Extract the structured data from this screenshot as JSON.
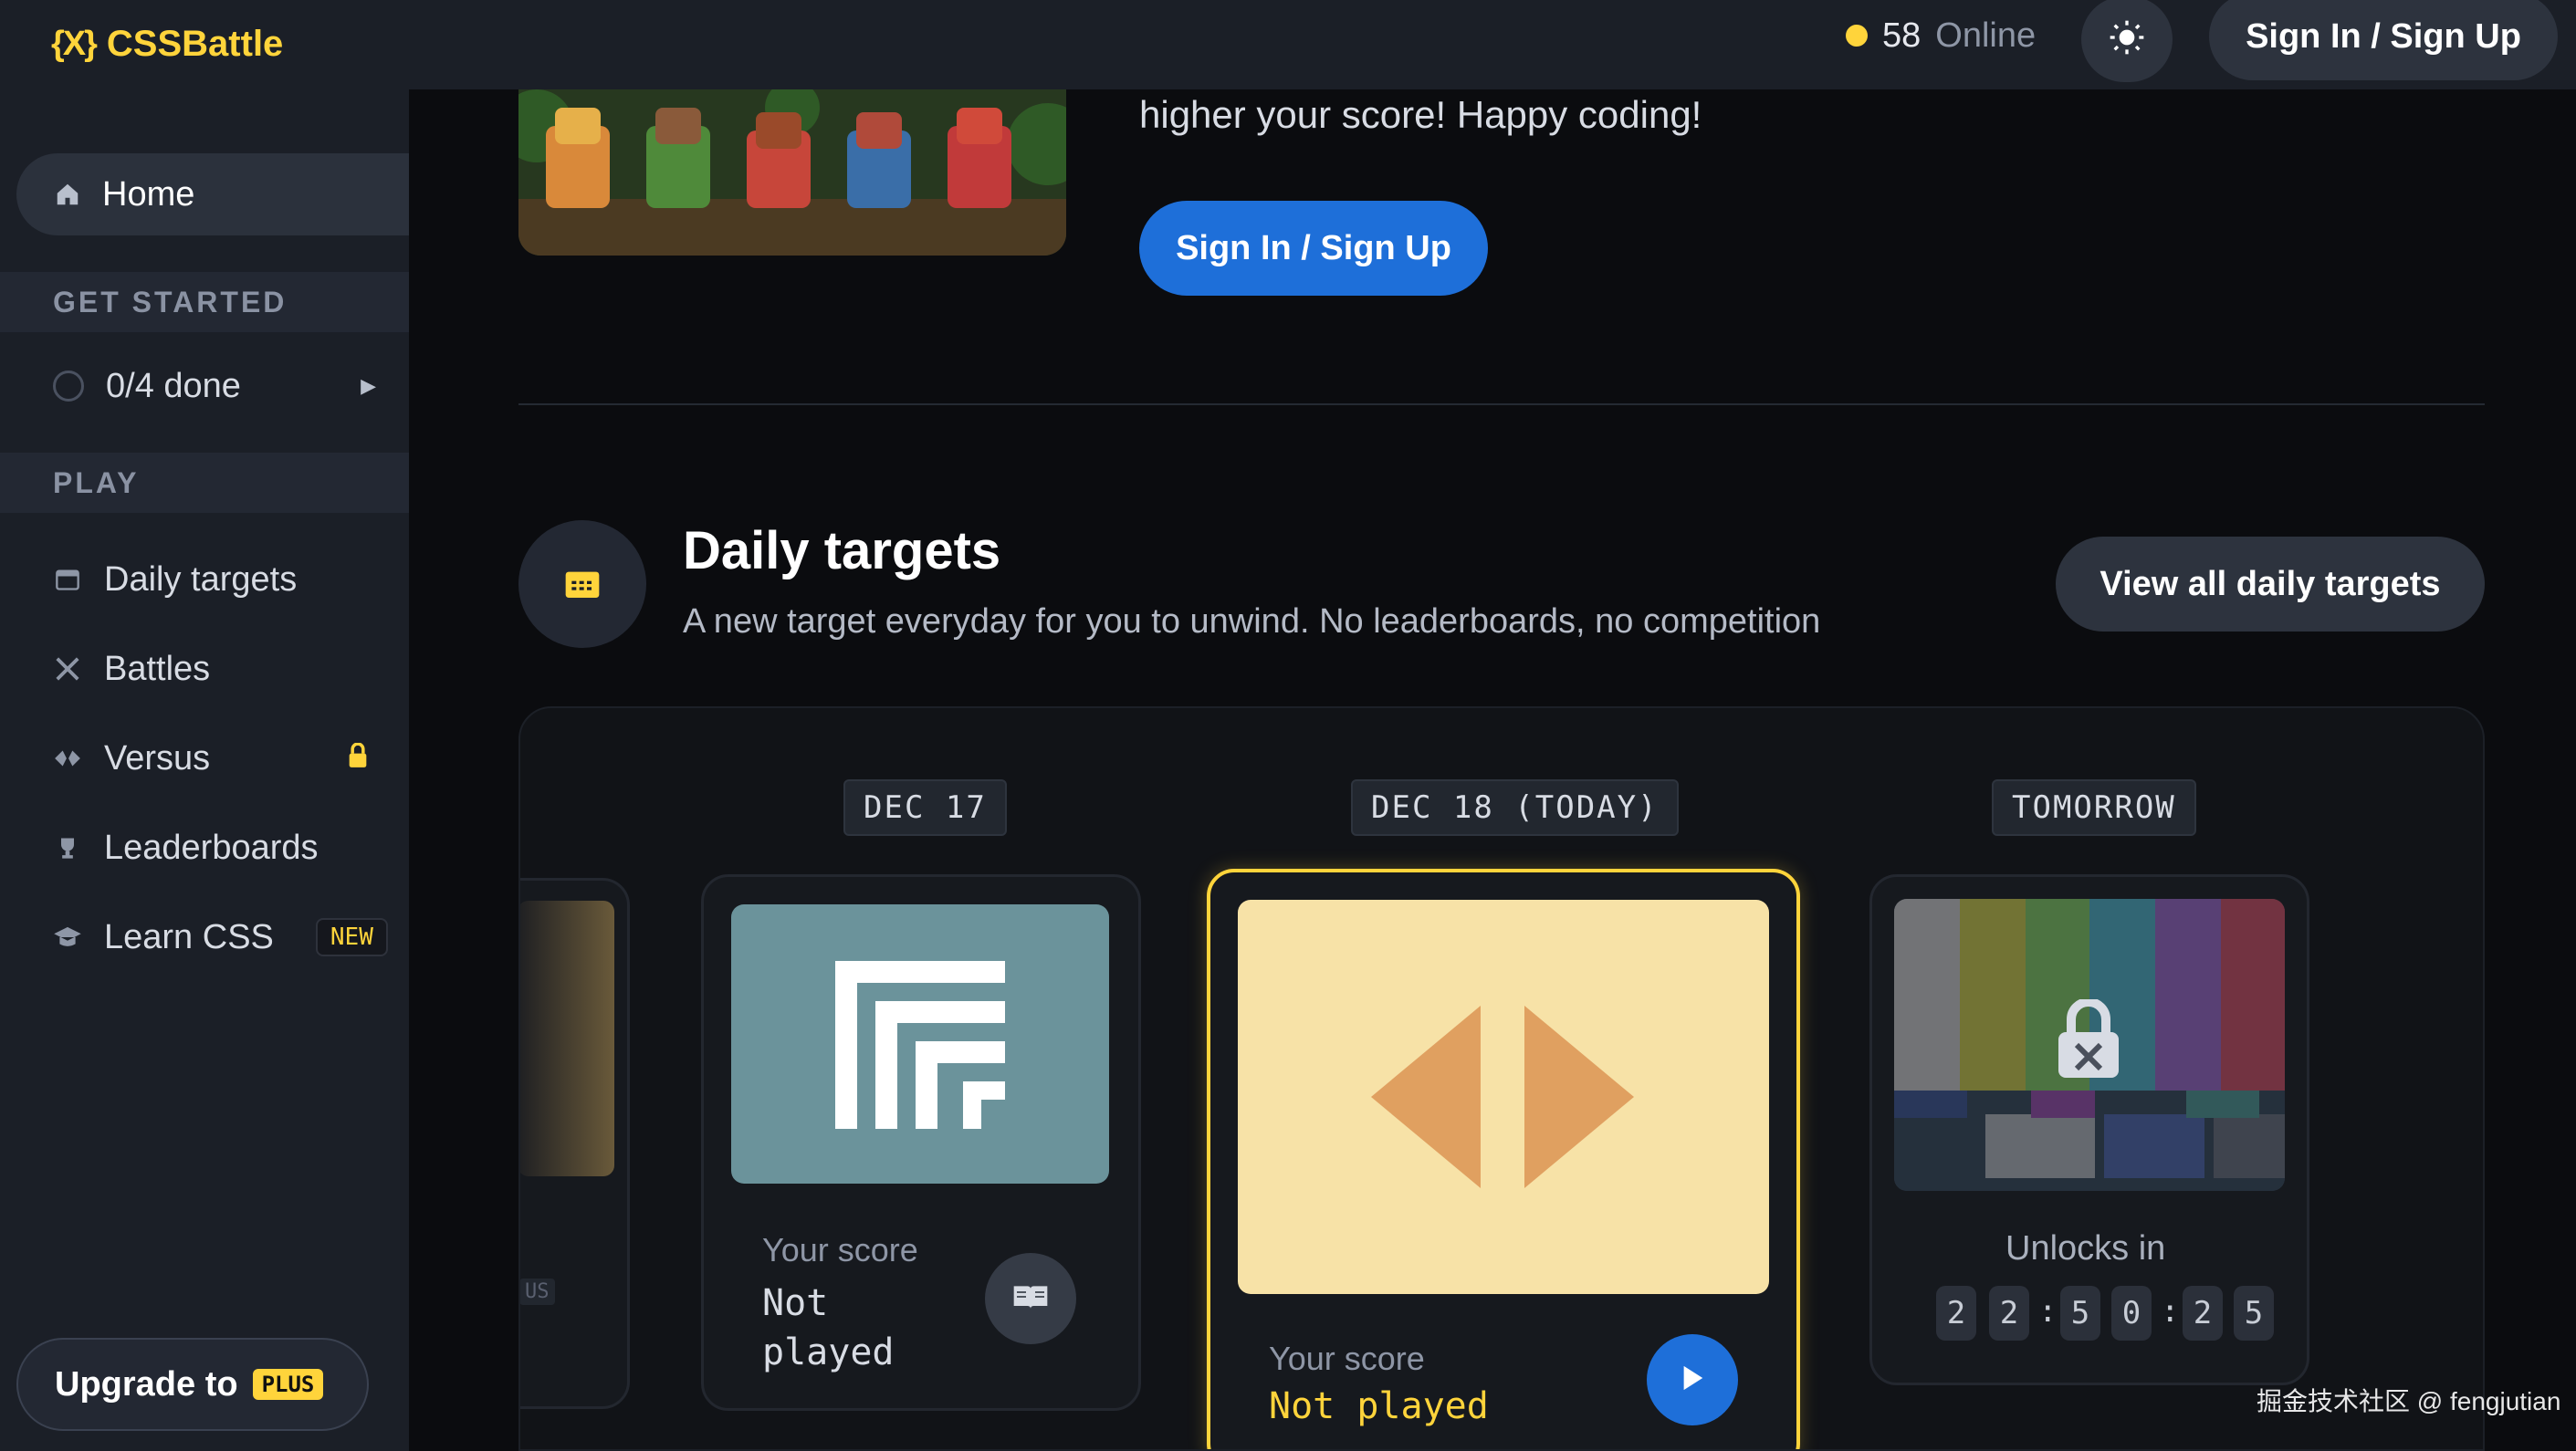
{
  "brand": {
    "name": "CSSBattle",
    "mark": "{X}"
  },
  "header": {
    "online_count": "58",
    "online_label": "Online",
    "sign_in": "Sign In / Sign Up"
  },
  "sidebar": {
    "home": "Home",
    "get_started": "GET STARTED",
    "progress": "0/4 done",
    "play": "PLAY",
    "items": [
      {
        "label": "Daily targets",
        "icon": "calendar-icon"
      },
      {
        "label": "Battles",
        "icon": "swords-icon"
      },
      {
        "label": "Versus",
        "icon": "versus-icon",
        "locked": true
      },
      {
        "label": "Leaderboards",
        "icon": "trophy-icon"
      },
      {
        "label": "Learn CSS",
        "icon": "graduation-cap-icon",
        "badge": "NEW"
      }
    ],
    "upgrade_label": "Upgrade to",
    "upgrade_badge": "PLUS"
  },
  "hero": {
    "text": "higher your score! Happy coding!",
    "button": "Sign In / Sign Up"
  },
  "daily": {
    "title": "Daily targets",
    "subtitle": "A new target everyday for you to unwind. No leaderboards, no competition",
    "view_all": "View all daily targets",
    "cards": [
      {
        "date": "DEC 17",
        "score_label": "Your score",
        "score_line1": "Not",
        "score_line2": "played"
      },
      {
        "date": "DEC 18 (TODAY)",
        "score_label": "Your score",
        "score": "Not played"
      },
      {
        "date": "TOMORROW",
        "unlock_label": "Unlocks in",
        "countdown": [
          "2",
          "2",
          "5",
          "0",
          "2",
          "5"
        ]
      }
    ],
    "partial_tag": "US"
  },
  "watermark": "掘金技术社区 @ fengjutian",
  "colors": {
    "accent": "#ffd43b",
    "primary": "#1e6fd9",
    "bg": "#0b0c0f",
    "sidebar": "#1b1f27"
  }
}
